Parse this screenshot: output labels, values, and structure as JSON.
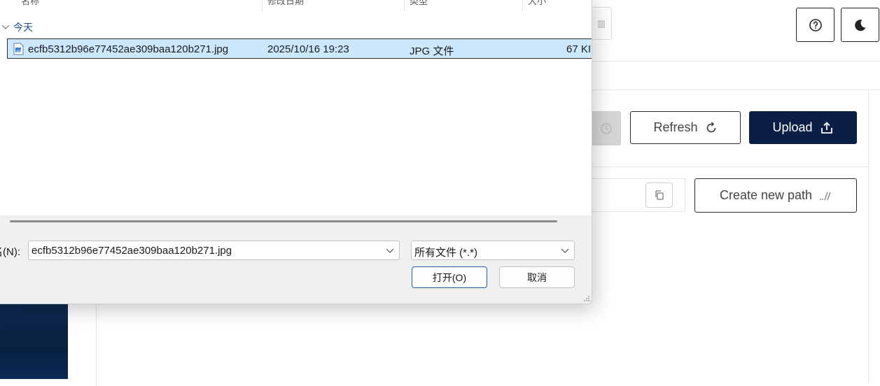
{
  "dialog": {
    "columns": [
      "名称",
      "修改日期",
      "类型",
      "大小"
    ],
    "group_label": "今天",
    "file": {
      "name": "ecfb5312b96e77452ae309baa120b271.jpg",
      "modified": "2025/10/16 19:23",
      "type": "JPG 文件",
      "size": "67 KI"
    },
    "filename_label": "名(N):",
    "filename_value": "ecfb5312b96e77452ae309baa120b271.jpg",
    "filetype_value": "所有文件 (*.*)",
    "open_label": "打开(O)",
    "cancel_label": "取消"
  },
  "app": {
    "refresh_label": "Refresh",
    "upload_label": "Upload",
    "create_path_label": "Create new path"
  },
  "icons": {
    "help": "question-circle-icon",
    "theme": "moon-icon",
    "refresh": "refresh-icon",
    "upload": "upload-icon",
    "copy": "copy-icon",
    "create_path": "path-slash-icon"
  },
  "colors": {
    "primary": "#0b1f45",
    "selection": "#cce8ff",
    "group_text": "#1f4f8c"
  }
}
